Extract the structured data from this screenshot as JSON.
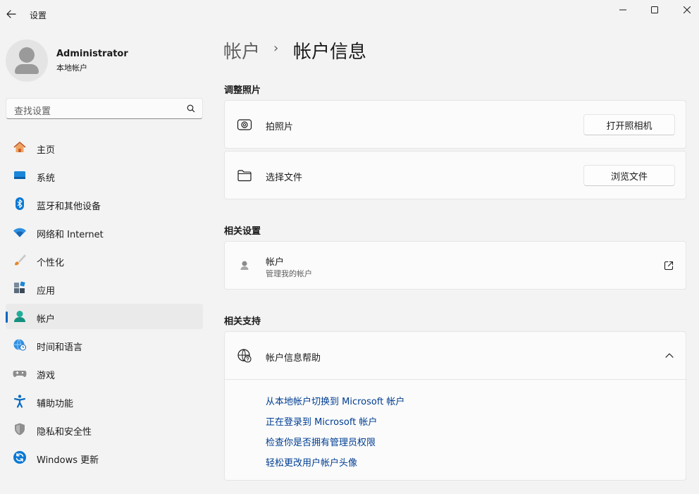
{
  "window": {
    "title": "设置"
  },
  "profile": {
    "name": "Administrator",
    "type": "本地帐户"
  },
  "search": {
    "placeholder": "查找设置"
  },
  "nav": [
    {
      "label": "主页",
      "icon": "home-icon"
    },
    {
      "label": "系统",
      "icon": "system-icon"
    },
    {
      "label": "蓝牙和其他设备",
      "icon": "bluetooth-icon"
    },
    {
      "label": "网络和 Internet",
      "icon": "wifi-icon"
    },
    {
      "label": "个性化",
      "icon": "brush-icon"
    },
    {
      "label": "应用",
      "icon": "apps-icon"
    },
    {
      "label": "帐户",
      "icon": "account-icon",
      "active": true
    },
    {
      "label": "时间和语言",
      "icon": "globe-clock-icon"
    },
    {
      "label": "游戏",
      "icon": "gamepad-icon"
    },
    {
      "label": "辅助功能",
      "icon": "accessibility-icon"
    },
    {
      "label": "隐私和安全性",
      "icon": "shield-icon"
    },
    {
      "label": "Windows 更新",
      "icon": "update-icon"
    }
  ],
  "breadcrumb": {
    "parent": "帐户",
    "separator": "›",
    "current": "帐户信息"
  },
  "adjust_photo": {
    "title": "调整照片",
    "take_photo": {
      "label": "拍照片",
      "button": "打开照相机",
      "icon": "camera-icon"
    },
    "choose_file": {
      "label": "选择文件",
      "button": "浏览文件",
      "icon": "folder-icon"
    }
  },
  "related_settings": {
    "title": "相关设置",
    "accounts": {
      "label": "帐户",
      "sub": "管理我的帐户",
      "icon": "person-icon"
    }
  },
  "related_support": {
    "title": "相关支持",
    "help": {
      "label": "帐户信息帮助",
      "icon": "globe-help-icon",
      "links": [
        "从本地帐户切换到 Microsoft 帐户",
        "正在登录到 Microsoft 帐户",
        "检查你是否拥有管理员权限",
        "轻松更改用户帐户头像"
      ]
    }
  },
  "colors": {
    "accent": "#0067c0",
    "link": "#003e92",
    "background": "#f3f3f3",
    "card": "#fbfbfb"
  }
}
